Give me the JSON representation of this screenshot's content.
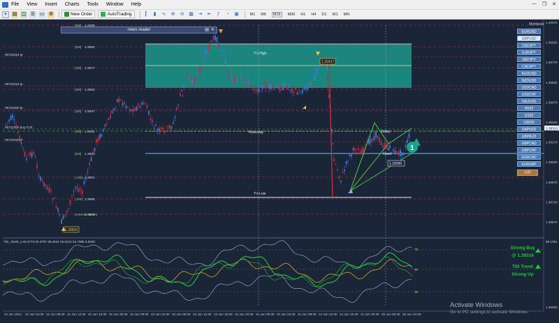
{
  "menu": [
    "File",
    "View",
    "Insert",
    "Charts",
    "Tools",
    "Window",
    "Help"
  ],
  "toolbar": {
    "new_order": "New Order",
    "auto_trading": "AutoTrading",
    "timeframes": [
      "M1",
      "M5",
      "M15",
      "M30",
      "H1",
      "H4",
      "D1",
      "W1",
      "MN"
    ],
    "active_timeframe": "M15"
  },
  "news_reader": {
    "title": "news reader"
  },
  "symbols_panel": {
    "title": "Myfxbook",
    "items": [
      "EURUSD",
      "GBPUSD",
      "USDJPY",
      "EURJPY",
      "GBPJPY",
      "CADJPY",
      "AUDUSD",
      "NZDUSD",
      "USDCAD",
      "USDCHF",
      "XAUUSD",
      "HK50",
      "US30",
      "US500",
      "GBPNZD",
      "GBPAUD",
      "GBPCAD",
      "GBPCHF",
      "EURCAD",
      "EURGBP"
    ],
    "selected": "GBPUSD",
    "extra": "AIR"
  },
  "levels": [
    {
      "label": "[6/8]",
      "value": "1.4008"
    },
    {
      "label": "[5/8]",
      "value": "1.3992"
    },
    {
      "label": "[4/8]",
      "value": "1.3977"
    },
    {
      "label": "[3/8]",
      "value": "1.3962"
    },
    {
      "label": "[2/8]",
      "value": "1.3947"
    },
    {
      "label": "[1/8]",
      "value": "1.3931"
    },
    {
      "label": "[0/8]",
      "value": "1.3916"
    },
    {
      "label": "[-1/8]",
      "value": "1.3901"
    },
    {
      "label": "[-2/8]",
      "value": "1.3885"
    },
    {
      "label": "Extreme Overs",
      "value": "1.3870"
    }
  ],
  "order_labels": [
    "#6722319 tp",
    "#6722318 tp",
    "#6722320 tp",
    "#6722320 buy 0.03",
    "#6722320 sl"
  ],
  "zone_labels": {
    "high": "Y's High",
    "yesterday": "Yesterday",
    "today": "Today",
    "open": "Open",
    "low": "Y's Low"
  },
  "price_tags": {
    "peak": "1.39437",
    "open": "1.39099",
    "low": "1.38604"
  },
  "price_axis": [
    "1.40070",
    "1.39920",
    "1.39770",
    "1.39620",
    "1.39470",
    "1.39320",
    "1.39170",
    "1.39020",
    "1.38870",
    "1.38720",
    "1.38570"
  ],
  "current_price": "1.39313",
  "circle_marker": "1",
  "indicator": {
    "label": "TDI_Alerts_v.43.4773 50.4797 39.4641 63.5212 54.7086 0.0000",
    "axis": [
      "75",
      "50",
      "25"
    ],
    "top_value": "88.1051",
    "bottom_value": "1.26000"
  },
  "tdi_panel": {
    "signal_line1": "Strong Buy",
    "signal_line2": "@ 1.39316",
    "trend_line1": "TDI Trend",
    "trend_line2": "Strong Up"
  },
  "time_axis": [
    "22 Jun 2021",
    "22 Jun 04:30",
    "22 Jun 08:30",
    "22 Jun 12:30",
    "22 Jun 16:30",
    "22 Jun 20:30",
    "23 Jun 00:30",
    "23 Jun 04:30",
    "23 Jun 08:30",
    "23 Jun 12:30",
    "23 Jun 16:30",
    "23 Jun 20:30",
    "24 Jun 00:30",
    "24 Jun 04:30",
    "24 Jun 08:30",
    "24 Jun 12:30",
    "24 Jun 16:30",
    "24 Jun 20:30",
    "25 Jun 00:30",
    "25 Jun 04:30"
  ],
  "watermark": {
    "title": "Activate Windows",
    "subtitle": "Go to PC settings to activate Windows."
  },
  "colors": {
    "background": "#1b2538",
    "zone_fill": "#19a393",
    "yellow_line": "#e6c14a",
    "blue_line": "#4e8ce8",
    "red_line": "#c0283a",
    "rsi_line": "#1fd83b",
    "signal_line": "#d1a829",
    "band_line": "#9fb9d8",
    "candle_up": "#3d7bd6",
    "candle_down": "#c72b3d"
  }
}
